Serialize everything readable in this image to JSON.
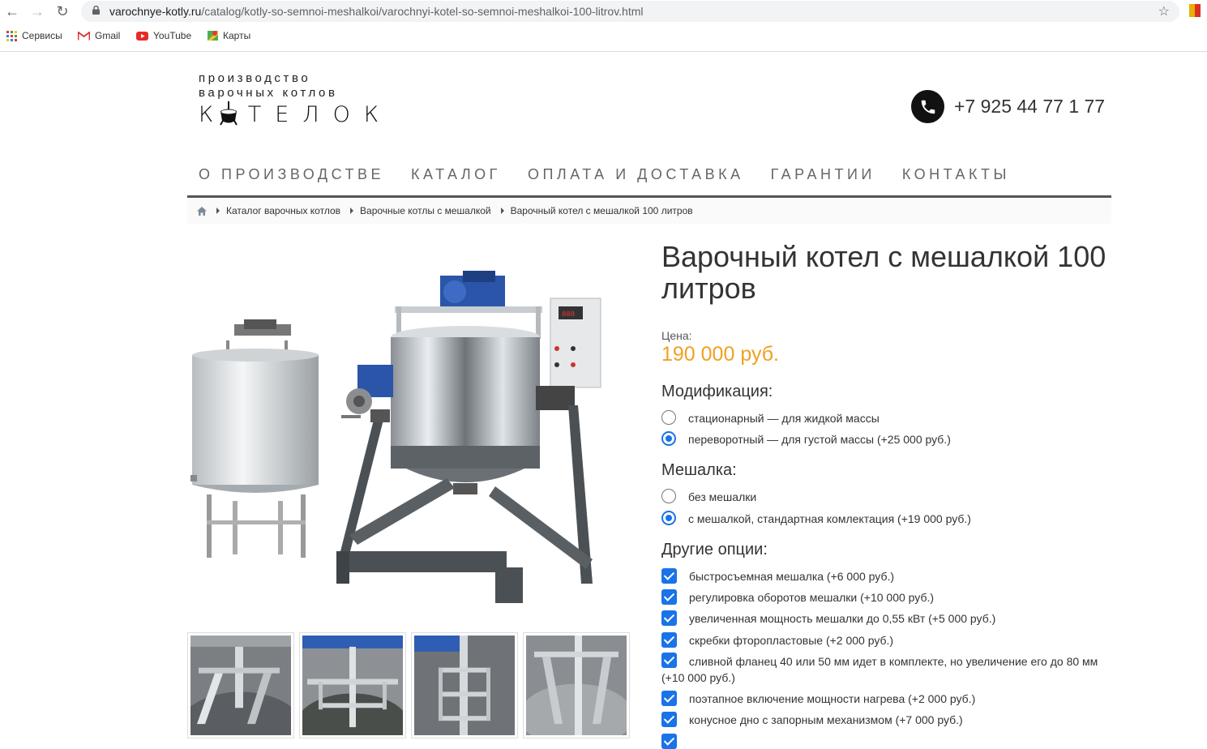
{
  "browser": {
    "url_host": "varochnye-kotly.ru",
    "url_path": "/catalog/kotly-so-semnoi-meshalkoi/varochnyi-kotel-so-semnoi-meshalkoi-100-litrov.html",
    "bookmarks": [
      "Сервисы",
      "Gmail",
      "YouTube",
      "Карты"
    ]
  },
  "logo": {
    "line1": "производство",
    "line2": "варочных котлов",
    "big": "К ТЕЛОК"
  },
  "phone": "+7 925 44 77 1 77",
  "menu": [
    "О ПРОИЗВОДСТВЕ",
    "КАТАЛОГ",
    "ОПЛАТА И ДОСТАВКА",
    "ГАРАНТИИ",
    "КОНТАКТЫ"
  ],
  "breadcrumb": [
    "Каталог варочных котлов",
    "Варочные котлы с мешалкой",
    "Варочный котел с мешалкой 100 литров"
  ],
  "product": {
    "title": "Варочный котел с мешалкой 100 литров",
    "price_label": "Цена:",
    "price": "190 000 руб.",
    "modification_heading": "Модификация:",
    "modification_options": [
      "стационарный — для жидкой массы",
      "переворотный — для густой массы (+25 000 руб.)"
    ],
    "modification_selected": 1,
    "mixer_heading": "Мешалка:",
    "mixer_options": [
      "без мешалки",
      "с мешалкой, стандартная комлектация (+19 000 руб.)"
    ],
    "mixer_selected": 1,
    "other_heading": "Другие опции:",
    "other_options": [
      "быстросъемная мешалка (+6 000 руб.)",
      "регулировка оборотов мешалки (+10 000 руб.)",
      "увеличенная мощность мешалки до 0,55 кВт (+5 000 руб.)",
      "скребки фторопластовые (+2 000 руб.)",
      "сливной фланец 40 или 50 мм идет в комплекте, но увеличение его до 80 мм (+10 000 руб.)",
      "поэтапное включение мощности нагрева (+2 000 руб.)",
      "конусное дно с запорным механизмом (+7 000 руб.)"
    ]
  },
  "colors": {
    "price": "#f0a020",
    "accent": "#1a73e8",
    "menu_text": "#666666"
  }
}
